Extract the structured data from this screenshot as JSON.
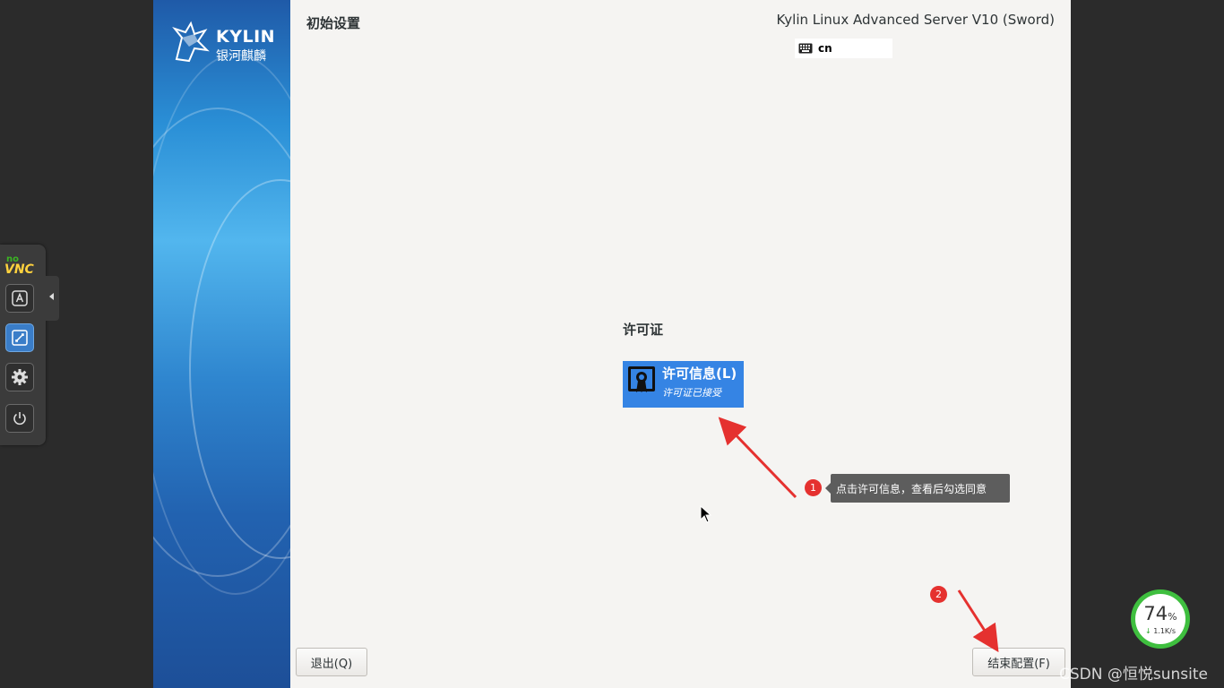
{
  "window": {
    "page_title": "初始设置",
    "product_name": "Kylin Linux Advanced Server V10 (Sword)",
    "keyboard_layout": "cn"
  },
  "logo": {
    "brand_en": "KYLIN",
    "brand_cn": "银河麒麟"
  },
  "license_section": {
    "title": "许可证",
    "spoke_title": "许可信息(L)",
    "spoke_status": "许可证已接受",
    "spoke_color": "#3584e4"
  },
  "buttons": {
    "quit": "退出(Q)",
    "finish": "结束配置(F)"
  },
  "annotations": {
    "marker1": "1",
    "marker2": "2",
    "tooltip": "点击许可信息，查看后勾选同意",
    "arrow_color": "#e5312f"
  },
  "novnc": {
    "logo_no": "no",
    "logo_vnc": "VNC",
    "buttons": [
      "keyboard-icon",
      "fullscreen-icon",
      "gear-icon",
      "power-icon"
    ]
  },
  "net_widget": {
    "percent": "74",
    "percent_symbol": "%",
    "speed": "1.1K/s"
  },
  "watermark": "CSDN @恒悦sunsite"
}
